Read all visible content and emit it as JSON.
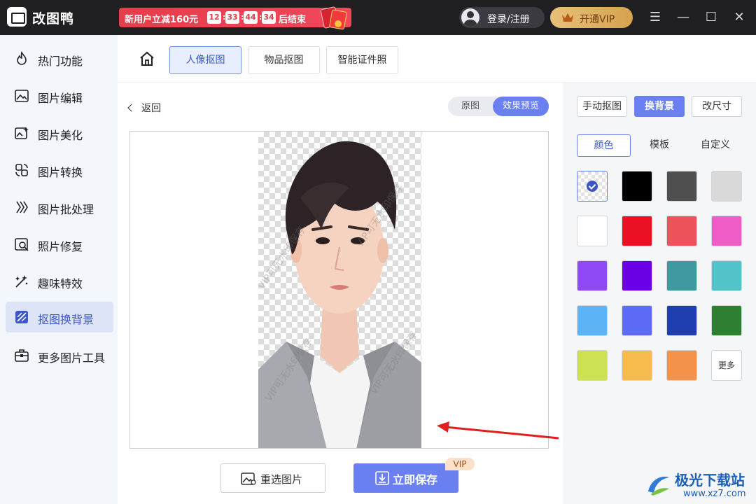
{
  "app": {
    "title": "改图鸭"
  },
  "promo": {
    "text": "新用户立减160元",
    "countdown": [
      "12",
      "33",
      "44",
      "34"
    ],
    "end_text": "后结束"
  },
  "header": {
    "login_label": "登录/注册",
    "vip_label": "开通VIP"
  },
  "sidebar": {
    "items": [
      {
        "label": "热门功能",
        "icon": "fire-icon"
      },
      {
        "label": "图片编辑",
        "icon": "image-edit-icon"
      },
      {
        "label": "图片美化",
        "icon": "image-beautify-icon"
      },
      {
        "label": "图片转换",
        "icon": "convert-icon"
      },
      {
        "label": "图片批处理",
        "icon": "batch-icon"
      },
      {
        "label": "照片修复",
        "icon": "photo-repair-icon"
      },
      {
        "label": "趣味特效",
        "icon": "magic-wand-icon"
      },
      {
        "label": "抠图换背景",
        "icon": "cutout-icon",
        "active": true
      },
      {
        "label": "更多图片工具",
        "icon": "toolbox-icon"
      }
    ]
  },
  "tabs": [
    {
      "label": "人像抠图",
      "active": true
    },
    {
      "label": "物品抠图"
    },
    {
      "label": "智能证件照"
    }
  ],
  "editor": {
    "back_label": "返回",
    "view_toggle": {
      "original": "原图",
      "preview": "效果预览",
      "selected": "效果预览"
    },
    "watermark_text": "VIP可无水印保存",
    "reselect_label": "重选图片",
    "save_label": "立即保存",
    "save_badge": "VIP"
  },
  "right_panel": {
    "mode_tabs": [
      {
        "label": "手动抠图"
      },
      {
        "label": "换背景",
        "active": true
      },
      {
        "label": "改尺寸"
      }
    ],
    "color_tabs": [
      {
        "label": "颜色",
        "active": true
      },
      {
        "label": "模板"
      },
      {
        "label": "自定义"
      }
    ],
    "swatches": [
      "transparent",
      "#000000",
      "#4f4f4f",
      "#d9d9d9",
      "#ffffff",
      "#ec1023",
      "#ee525a",
      "#ee5cc6",
      "#8f49f5",
      "#6a00e6",
      "#3e9aa0",
      "#54c4cb",
      "#5cb3f6",
      "#5d6bf7",
      "#1f3fb0",
      "#2e7f31",
      "#cde152",
      "#f6bb4e",
      "#f3924a"
    ],
    "selected_swatch": 0,
    "more_label": "更多"
  },
  "site_logo": {
    "name": "极光下载站",
    "url": "www.xz7.com"
  },
  "colors": {
    "accent": "#6a7ff0",
    "accent_text": "#3b56c6",
    "titlebar": "#1f1f22"
  }
}
